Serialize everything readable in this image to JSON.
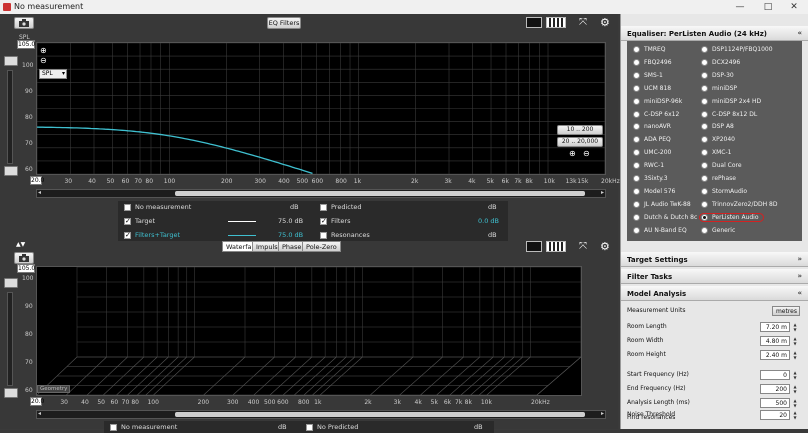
{
  "window": {
    "title": "No measurement",
    "minimize": "—",
    "maximize": "□",
    "close": "✕"
  },
  "top_panel": {
    "eq_filters_button": "EQ Filters",
    "y_unit": "SPL",
    "y_top_value": "105.0",
    "spl_select": "SPL",
    "y_ticks": [
      "100",
      "90",
      "80",
      "70",
      "60"
    ],
    "x_start": "20.0",
    "x_ticks": [
      "30",
      "40",
      "50",
      "60",
      "70",
      "80",
      "100",
      "200",
      "300",
      "400",
      "500",
      "600",
      "800",
      "1k",
      "2k",
      "3k",
      "4k",
      "5k",
      "6k",
      "7k",
      "8k",
      "10k",
      "13k",
      "15k",
      "20kHz"
    ],
    "range_btn_1": "10 .. 200",
    "range_btn_2": "20 .. 20,000",
    "legend": {
      "no_measurement": "No measurement",
      "no_measurement_unit": "dB",
      "predicted": "Predicted",
      "predicted_unit": "dB",
      "target": "Target",
      "target_value": "75.0 dB",
      "filters": "Filters",
      "filters_value": "0.0 dB",
      "filters_target": "Filters+Target",
      "filters_target_value": "75.0 dB",
      "resonances": "Resonances",
      "resonances_unit": "dB"
    }
  },
  "bottom_panel": {
    "tabs": [
      "Waterfall",
      "Impulse",
      "Phase",
      "Pole-Zero"
    ],
    "y_top_value": "105.0",
    "y_ticks": [
      "100",
      "90",
      "80",
      "70",
      "60"
    ],
    "x_start": "20.0",
    "x_ticks": [
      "30",
      "40",
      "50",
      "60",
      "70",
      "80",
      "100",
      "200",
      "300",
      "400",
      "500",
      "600",
      "800",
      "1k",
      "2k",
      "3k",
      "4k",
      "5k",
      "6k",
      "7k",
      "8k",
      "10k",
      "20kHz"
    ],
    "overlay_label": "Geometry",
    "legend": {
      "no_measurement": "No measurement",
      "no_measurement_unit": "dB",
      "no_predicted": "No Predicted",
      "no_predicted_unit": "dB"
    }
  },
  "right_panel": {
    "equaliser_title": "Equaliser: PerListen Audio (24 kHz)",
    "eq_left": [
      "TMREQ",
      "FBQ2496",
      "SMS-1",
      "UCM 818",
      "miniDSP-96k",
      "C-DSP 6x12",
      "nanoAVR",
      "ADA PEQ",
      "UMC-200",
      "RWC-1",
      "3Sixty.3",
      "Model 576",
      "JL Audio TwK-88",
      "Dutch & Dutch 8c",
      "AU N-Band EQ"
    ],
    "eq_right": [
      "DSP1124P/FBQ1000",
      "DCX2496",
      "DSP-30",
      "miniDSP",
      "miniDSP 2x4 HD",
      "C-DSP 8x12 DL",
      "DSP A8",
      "XP2040",
      "XMC-1",
      "Dual Core",
      "rePhase",
      "StormAudio",
      "TrinnovZero2/DDH 8D",
      "PerListen Audio",
      "Generic"
    ],
    "eq_selected": "PerListen Audio",
    "target_settings": "Target Settings",
    "filter_tasks": "Filter Tasks",
    "model_analysis": "Model Analysis",
    "ma_fields": [
      {
        "label": "Measurement Units",
        "value": "metres"
      },
      {
        "label": "Room Length",
        "value": "7.20 m"
      },
      {
        "label": "Room Width",
        "value": "4.80 m"
      },
      {
        "label": "Room Height",
        "value": "2.40 m"
      },
      {
        "label": "Start Frequency (Hz)",
        "value": "0"
      },
      {
        "label": "End Frequency (Hz)",
        "value": "200"
      },
      {
        "label": "Analysis Length (ms)",
        "value": "500"
      },
      {
        "label": "Noise Threshold",
        "value": "20"
      }
    ],
    "find_resonances": "Find resonances",
    "chevron_up": "«",
    "chevron_down": "»"
  },
  "target_curve": {
    "flat_level_db": 75.0,
    "corner_hz": 100
  },
  "colors": {
    "target_line": "#ffffff",
    "filters_target_line": "#3fc0d0",
    "selected_ring": "#d22222"
  }
}
